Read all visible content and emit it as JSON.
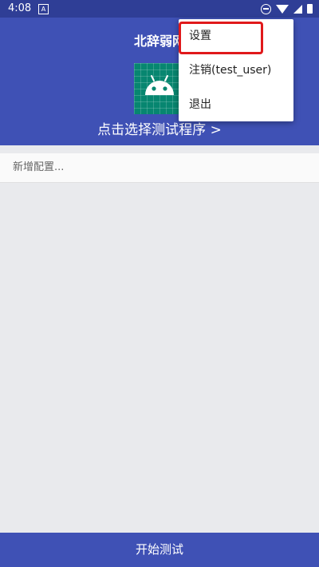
{
  "status_bar": {
    "time": "4:08",
    "notification_icon_label": "A"
  },
  "header": {
    "title": "北辞弱网",
    "select_program": "点击选择测试程序 >"
  },
  "config": {
    "placeholder": "新增配置..."
  },
  "footer": {
    "start_label": "开始测试"
  },
  "menu": {
    "items": [
      {
        "label": "设置"
      },
      {
        "label": "注销(test_user)"
      },
      {
        "label": "退出"
      }
    ]
  },
  "colors": {
    "primary": "#3f51b5",
    "primary_dark": "#2f3e96",
    "icon_bg": "#078670",
    "highlight": "#e0191b"
  }
}
